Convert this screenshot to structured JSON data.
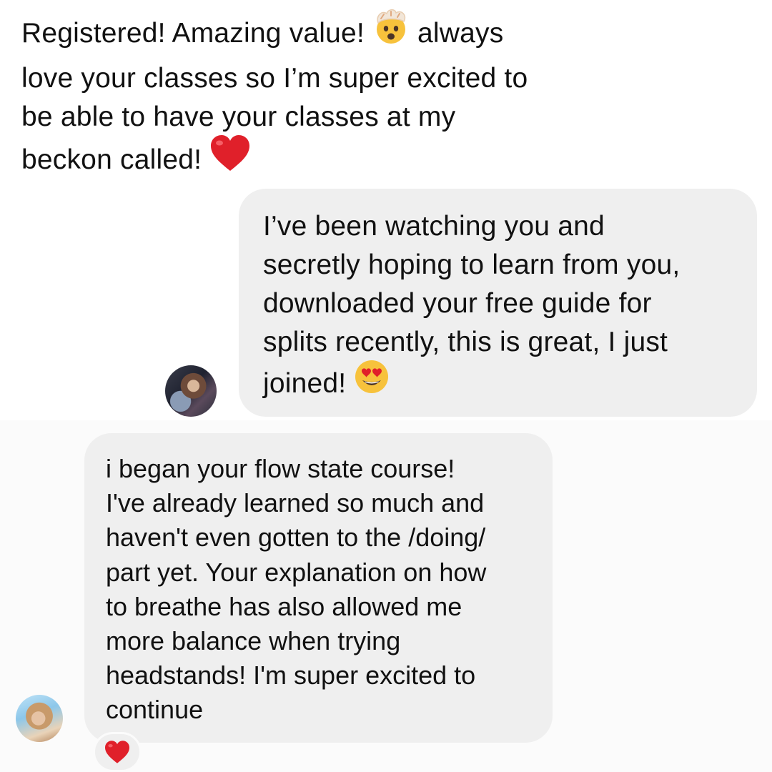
{
  "messages": [
    {
      "part_before_emoji": "Registered! Amazing value! ",
      "emoji_1": "shocked-face-with-exploding-head-icon",
      "part_after_emoji": " always\nlove your classes so I’m super excited to\nbe able to have your classes at my\nbeckon called! ",
      "emoji_2": "red-heart-icon"
    },
    {
      "text": "I’ve been watching you and\nsecretly hoping to learn from you,\ndownloaded your free guide for\nsplits recently, this is great, I just\njoined! ",
      "emoji": "smiling-face-with-heart-eyes-icon"
    },
    {
      "text": "i began your flow state course!\nI've already learned so much and\nhaven't even gotten to the /doing/\npart yet. Your explanation on how\nto breathe has also allowed me\nmore balance when trying\nheadstands! I'm super excited to\ncontinue",
      "reaction": "red-heart-icon"
    }
  ],
  "colors": {
    "bubble": "#efefef",
    "text": "#111111",
    "heart": "#e0202a"
  }
}
